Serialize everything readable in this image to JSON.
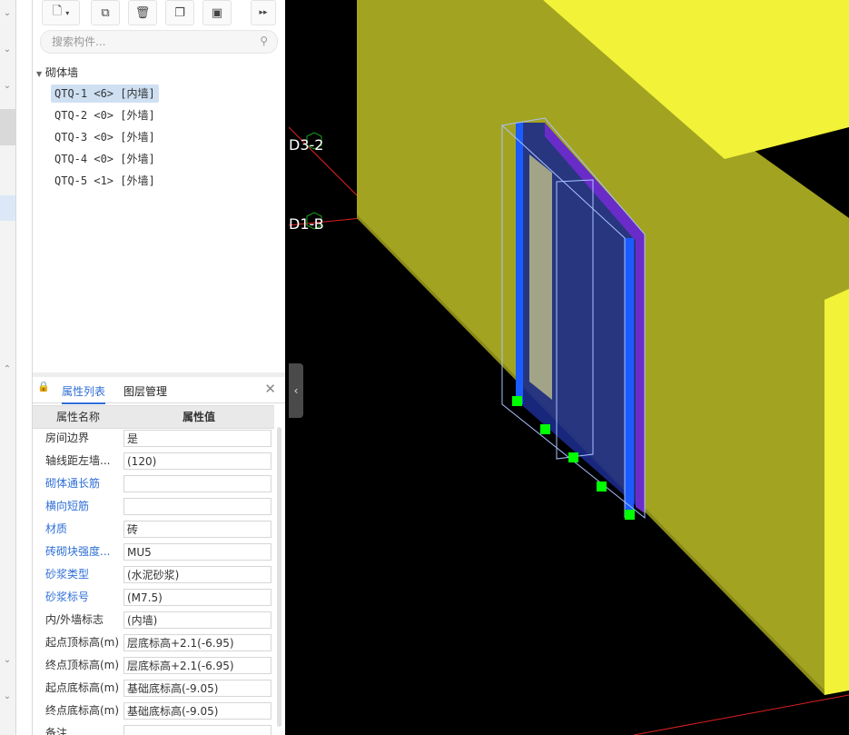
{
  "toolbar": {
    "buttons": [
      "new-component-icon",
      "copy-icon",
      "delete-icon",
      "duplicate-icon",
      "save-template-icon",
      "more-icon"
    ]
  },
  "search": {
    "placeholder": "搜索构件..."
  },
  "tree": {
    "root_label": "砌体墙",
    "items": [
      {
        "label": "QTQ-1 <6> [内墙]",
        "selected": true
      },
      {
        "label": "QTQ-2 <0> [外墙]",
        "selected": false
      },
      {
        "label": "QTQ-3 <0> [外墙]",
        "selected": false
      },
      {
        "label": "QTQ-4 <0> [外墙]",
        "selected": false
      },
      {
        "label": "QTQ-5 <1> [外墙]",
        "selected": false
      }
    ]
  },
  "props": {
    "tabs": [
      "属性列表",
      "图层管理"
    ],
    "header": {
      "name": "属性名称",
      "value": "属性值"
    },
    "rows": [
      {
        "name": "房间边界",
        "value": "是",
        "blue": false
      },
      {
        "name": "轴线距左墙...",
        "value": "(120)",
        "blue": false
      },
      {
        "name": "砌体通长筋",
        "value": "",
        "blue": true
      },
      {
        "name": "横向短筋",
        "value": "",
        "blue": true
      },
      {
        "name": "材质",
        "value": "砖",
        "blue": true
      },
      {
        "name": "砖砌块强度...",
        "value": "MU5",
        "blue": true
      },
      {
        "name": "砂浆类型",
        "value": "(水泥砂浆)",
        "blue": true
      },
      {
        "name": "砂浆标号",
        "value": "(M7.5)",
        "blue": true
      },
      {
        "name": "内/外墙标志",
        "value": "(内墙)",
        "blue": false
      },
      {
        "name": "起点顶标高(m)",
        "value": "层底标高+2.1(-6.95)",
        "blue": false
      },
      {
        "name": "终点顶标高(m)",
        "value": "层底标高+2.1(-6.95)",
        "blue": false
      },
      {
        "name": "起点底标高(m)",
        "value": "基础底标高(-9.05)",
        "blue": false
      },
      {
        "name": "终点底标高(m)",
        "value": "基础底标高(-9.05)",
        "blue": false
      },
      {
        "name": "备注",
        "value": "",
        "blue": false
      }
    ]
  },
  "viewport": {
    "axis_labels": [
      "D3-2",
      "D1-B"
    ],
    "colors": {
      "wall": "#c8c832",
      "wall_dark": "#a0a020",
      "wall_bright": "#f2f240",
      "grip": "#00ff00",
      "selection": "#1a5cff"
    }
  }
}
